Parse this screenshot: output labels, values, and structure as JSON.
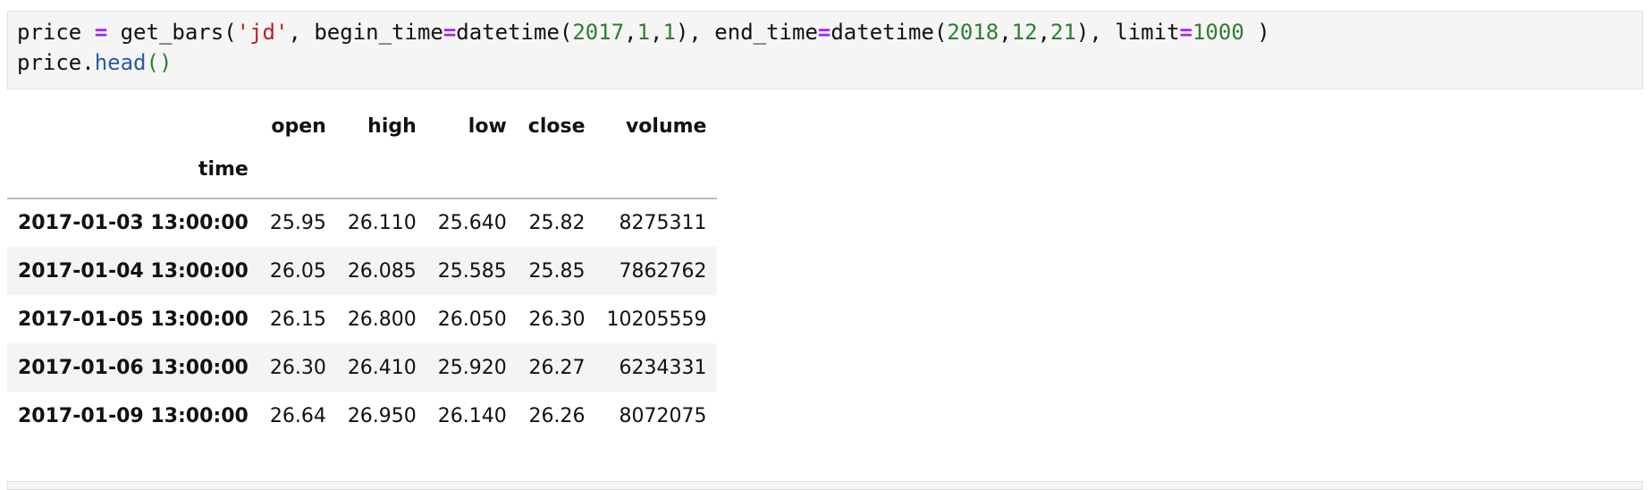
{
  "code_cell": {
    "line1": [
      {
        "t": "price ",
        "c": ""
      },
      {
        "t": "=",
        "c": "tok-kw"
      },
      {
        "t": " get_bars(",
        "c": ""
      },
      {
        "t": "'jd'",
        "c": "tok-str"
      },
      {
        "t": ", begin_time",
        "c": ""
      },
      {
        "t": "=",
        "c": "tok-kw"
      },
      {
        "t": "datetime(",
        "c": ""
      },
      {
        "t": "2017",
        "c": "tok-num"
      },
      {
        "t": ",",
        "c": ""
      },
      {
        "t": "1",
        "c": "tok-num"
      },
      {
        "t": ",",
        "c": ""
      },
      {
        "t": "1",
        "c": "tok-num"
      },
      {
        "t": "), end_time",
        "c": ""
      },
      {
        "t": "=",
        "c": "tok-kw"
      },
      {
        "t": "datetime(",
        "c": ""
      },
      {
        "t": "2018",
        "c": "tok-num"
      },
      {
        "t": ",",
        "c": ""
      },
      {
        "t": "12",
        "c": "tok-num"
      },
      {
        "t": ",",
        "c": ""
      },
      {
        "t": "21",
        "c": "tok-num"
      },
      {
        "t": "), limit",
        "c": ""
      },
      {
        "t": "=",
        "c": "tok-kw"
      },
      {
        "t": "1000",
        "c": "tok-num"
      },
      {
        "t": " )",
        "c": ""
      }
    ],
    "line2": [
      {
        "t": "price.",
        "c": ""
      },
      {
        "t": "head",
        "c": "tok-fn"
      },
      {
        "t": "()",
        "c": "tok-paren"
      }
    ]
  },
  "output_table": {
    "columns": [
      "open",
      "high",
      "low",
      "close",
      "volume"
    ],
    "index_name": "time",
    "rows": [
      {
        "index": "2017-01-03 13:00:00",
        "values": [
          "25.95",
          "26.110",
          "25.640",
          "25.82",
          "8275311"
        ]
      },
      {
        "index": "2017-01-04 13:00:00",
        "values": [
          "26.05",
          "26.085",
          "25.585",
          "25.85",
          "7862762"
        ]
      },
      {
        "index": "2017-01-05 13:00:00",
        "values": [
          "26.15",
          "26.800",
          "26.050",
          "26.30",
          "10205559"
        ]
      },
      {
        "index": "2017-01-06 13:00:00",
        "values": [
          "26.30",
          "26.410",
          "25.920",
          "26.27",
          "6234331"
        ]
      },
      {
        "index": "2017-01-09 13:00:00",
        "values": [
          "26.64",
          "26.950",
          "26.140",
          "26.26",
          "8072075"
        ]
      }
    ]
  }
}
